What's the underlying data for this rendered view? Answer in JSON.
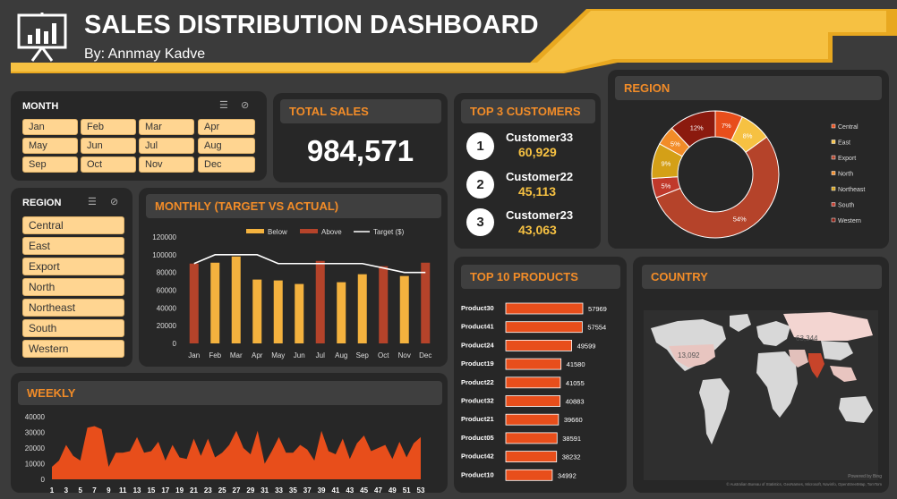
{
  "header": {
    "title": "SALES DISTRIBUTION DASHBOARD",
    "subtitle": "By: Annmay Kadve"
  },
  "month_slicer": {
    "title": "MONTH",
    "items": [
      "Jan",
      "Feb",
      "Mar",
      "Apr",
      "May",
      "Jun",
      "Jul",
      "Aug",
      "Sep",
      "Oct",
      "Nov",
      "Dec"
    ]
  },
  "region_slicer": {
    "title": "REGION",
    "items": [
      "Central",
      "East",
      "Export",
      "North",
      "Northeast",
      "South",
      "Western"
    ]
  },
  "total_sales": {
    "title": "TOTAL SALES",
    "value": "984,571"
  },
  "top_customers": {
    "title": "TOP 3 CUSTOMERS",
    "items": [
      {
        "rank": "1",
        "name": "Customer33",
        "value": "60,929"
      },
      {
        "rank": "2",
        "name": "Customer22",
        "value": "45,113"
      },
      {
        "rank": "3",
        "name": "Customer23",
        "value": "43,063"
      }
    ]
  },
  "region_chart": {
    "title": "REGION"
  },
  "monthly_chart": {
    "title": "MONTHLY (TARGET VS ACTUAL)"
  },
  "products_chart": {
    "title": "TOP 10 PRODUCTS"
  },
  "country_map": {
    "title": "COUNTRY",
    "label_a": "13,092",
    "label_b": "63,344",
    "credit_top": "Powered by Bing",
    "credit_bottom": "© Australian Bureau of Statistics, GeoNames, Microsoft, Navinfo, OpenStreetMap, TomTom"
  },
  "weekly_chart": {
    "title": "WEEKLY"
  },
  "colors": {
    "accent": "#f28c28",
    "below": "#f4b23e",
    "above": "#b5432a",
    "bar": "#e84e1b",
    "gold": "#f6c142"
  },
  "chart_data": [
    {
      "type": "bar",
      "title": "MONTHLY (TARGET VS ACTUAL)",
      "categories": [
        "Jan",
        "Feb",
        "Mar",
        "Apr",
        "May",
        "Jun",
        "Jul",
        "Aug",
        "Sep",
        "Oct",
        "Nov",
        "Dec"
      ],
      "ylim": [
        0,
        120000
      ],
      "yticks": [
        "0",
        "20000",
        "40000",
        "60000",
        "80000",
        "100000",
        "120000"
      ],
      "series": [
        {
          "name": "Below",
          "values": [
            0,
            91000,
            98000,
            72000,
            71000,
            67000,
            0,
            69000,
            78000,
            0,
            76000,
            0
          ]
        },
        {
          "name": "Above",
          "values": [
            90000,
            0,
            0,
            0,
            0,
            0,
            93000,
            0,
            0,
            87000,
            0,
            91000
          ]
        },
        {
          "name": "Target ($)",
          "values": [
            90000,
            100000,
            100000,
            100000,
            90000,
            90000,
            90000,
            90000,
            90000,
            85000,
            80000,
            80000
          ]
        }
      ]
    },
    {
      "type": "pie",
      "title": "REGION",
      "categories": [
        "Central",
        "East",
        "Export",
        "North",
        "Northeast",
        "South",
        "Western"
      ],
      "values": [
        7,
        8,
        54,
        5,
        9,
        5,
        12
      ],
      "labels": [
        "7%",
        "8%",
        "54%",
        "5%",
        "9%",
        "5%",
        "12%"
      ],
      "colors": [
        "#e84e1b",
        "#f6c142",
        "#b5432a",
        "#f28c28",
        "#d4a017",
        "#c0392b",
        "#8b1a0e"
      ]
    },
    {
      "type": "bar",
      "title": "TOP 10 PRODUCTS",
      "categories": [
        "Product30",
        "Product41",
        "Product24",
        "Product19",
        "Product22",
        "Product32",
        "Product21",
        "Product05",
        "Product42",
        "Product10"
      ],
      "values": [
        57969,
        57554,
        49599,
        41580,
        41055,
        40883,
        39660,
        38591,
        38232,
        34992
      ]
    },
    {
      "type": "area",
      "title": "WEEKLY",
      "ylim": [
        0,
        40000
      ],
      "yticks": [
        "0",
        "10000",
        "20000",
        "30000",
        "40000"
      ],
      "xticks": [
        "1",
        "3",
        "5",
        "7",
        "9",
        "11",
        "13",
        "15",
        "17",
        "19",
        "21",
        "23",
        "25",
        "27",
        "29",
        "31",
        "33",
        "35",
        "37",
        "39",
        "41",
        "43",
        "45",
        "47",
        "49",
        "51",
        "53"
      ],
      "x": [
        1,
        2,
        3,
        4,
        5,
        6,
        7,
        8,
        9,
        10,
        11,
        12,
        13,
        14,
        15,
        16,
        17,
        18,
        19,
        20,
        21,
        22,
        23,
        24,
        25,
        26,
        27,
        28,
        29,
        30,
        31,
        32,
        33,
        34,
        35,
        36,
        37,
        38,
        39,
        40,
        41,
        42,
        43,
        44,
        45,
        46,
        47,
        48,
        49,
        50,
        51,
        52,
        53
      ],
      "values": [
        8000,
        12000,
        22000,
        15000,
        12000,
        33000,
        34000,
        32000,
        8000,
        17000,
        17000,
        18000,
        27000,
        17000,
        18000,
        24000,
        12000,
        22000,
        14000,
        13000,
        26000,
        15000,
        26000,
        14000,
        17000,
        22000,
        31000,
        20000,
        16000,
        31000,
        10000,
        18000,
        27000,
        17000,
        17000,
        22000,
        19000,
        12000,
        31000,
        18000,
        16000,
        26000,
        13000,
        23000,
        28000,
        18000,
        20000,
        22000,
        13000,
        24000,
        14000,
        23000,
        27000
      ]
    }
  ]
}
